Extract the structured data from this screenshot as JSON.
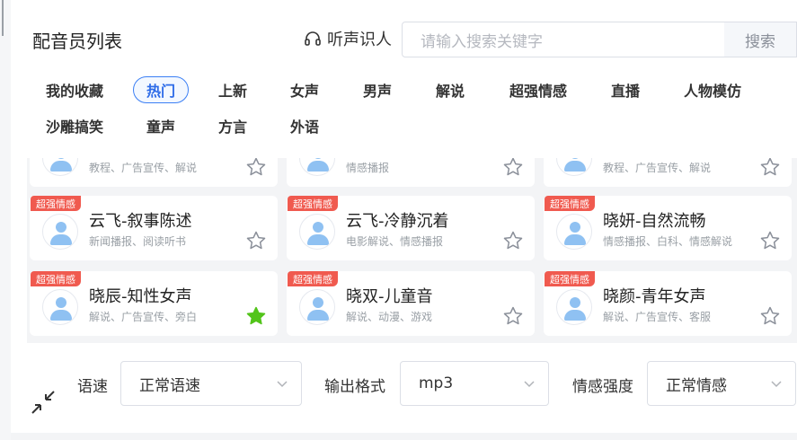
{
  "header": {
    "title": "配音员列表",
    "listen_label": "听声识人",
    "search_placeholder": "请输入搜索关键字",
    "search_button": "搜索"
  },
  "categories": [
    {
      "label": "我的收藏",
      "active": false
    },
    {
      "label": "热门",
      "active": true
    },
    {
      "label": "上新",
      "active": false
    },
    {
      "label": "女声",
      "active": false
    },
    {
      "label": "男声",
      "active": false
    },
    {
      "label": "解说",
      "active": false
    },
    {
      "label": "超强情感",
      "active": false
    },
    {
      "label": "直播",
      "active": false
    },
    {
      "label": "人物模仿",
      "active": false
    },
    {
      "label": "沙雕搞笑",
      "active": false
    },
    {
      "label": "童声",
      "active": false
    },
    {
      "label": "方言",
      "active": false
    },
    {
      "label": "外语",
      "active": false
    }
  ],
  "voices": [
    {
      "badge": "",
      "name": "",
      "tags": "教程、广告宣传、解说",
      "favorite": false
    },
    {
      "badge": "",
      "name": "",
      "tags": "情感播报",
      "favorite": false
    },
    {
      "badge": "",
      "name": "",
      "tags": "教程、广告宣传、解说",
      "favorite": false
    },
    {
      "badge": "超强情感",
      "name": "云飞-叙事陈述",
      "tags": "新闻播报、阅读听书",
      "favorite": false
    },
    {
      "badge": "超强情感",
      "name": "云飞-冷静沉着",
      "tags": "电影解说、情感播报",
      "favorite": false
    },
    {
      "badge": "超强情感",
      "name": "晓妍-自然流畅",
      "tags": "情感播报、白科、情感解说",
      "favorite": false
    },
    {
      "badge": "超强情感",
      "name": "晓辰-知性女声",
      "tags": "解说、广告宣传、旁白",
      "favorite": true
    },
    {
      "badge": "超强情感",
      "name": "晓双-儿童音",
      "tags": "解说、动漫、游戏",
      "favorite": false
    },
    {
      "badge": "超强情感",
      "name": "晓颜-青年女声",
      "tags": "解说、广告宣传、客服",
      "favorite": false
    }
  ],
  "settings": {
    "speed_label": "语速",
    "speed_value": "正常语速",
    "format_label": "输出格式",
    "format_value": "mp3",
    "emotion_label": "情感强度",
    "emotion_value": "正常情感"
  },
  "colors": {
    "accent": "#2d6be8",
    "badge": "#f05a4f",
    "favorite": "#52c41a",
    "avatar": "#8fc1f2"
  }
}
